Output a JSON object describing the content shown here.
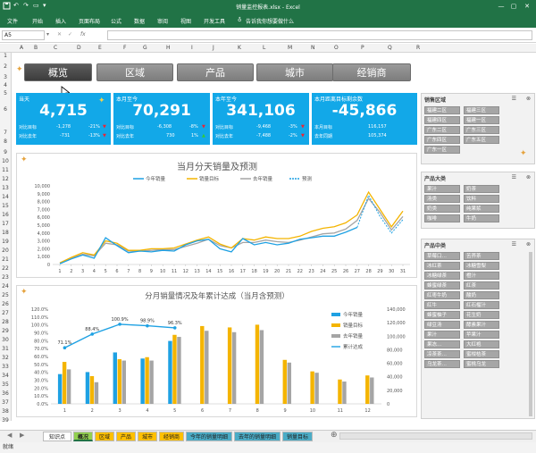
{
  "window": {
    "title": "销量监控报表.xlsx - Excel"
  },
  "ribbon": {
    "tabs": [
      "文件",
      "开始",
      "插入",
      "页面布局",
      "公式",
      "数据",
      "审阅",
      "视图",
      "开发工具"
    ],
    "search": "告诉我你想要做什么"
  },
  "formula": {
    "namebox": "A5",
    "fx": "fx"
  },
  "columns": [
    "A",
    "B",
    "C",
    "D",
    "E",
    "F",
    "G",
    "H",
    "I",
    "J",
    "K",
    "L",
    "M",
    "N",
    "O",
    "P",
    "Q",
    "R"
  ],
  "rows": [
    "1",
    "2",
    "3",
    "4",
    "5",
    "6",
    "7",
    "8",
    "9",
    "10",
    "11",
    "12",
    "13",
    "14",
    "15",
    "16",
    "17",
    "18",
    "19",
    "20",
    "21",
    "22",
    "23",
    "24",
    "25",
    "26",
    "27",
    "28",
    "29",
    "30",
    "31",
    "32",
    "33",
    "34",
    "35",
    "36",
    "37",
    "38",
    "39",
    "40",
    "41"
  ],
  "nav": [
    "概览",
    "区域",
    "产品",
    "城市",
    "经销商"
  ],
  "kpis": [
    {
      "label": "当天",
      "value": "4,715",
      "r1": [
        "对比目标",
        "-1,278",
        "-21%"
      ],
      "r2": [
        "对比去年",
        "-731",
        "-13%"
      ]
    },
    {
      "label": "本月至今",
      "value": "70,291",
      "r1": [
        "对比目标",
        "-6,308",
        "-8%"
      ],
      "r2": [
        "对比去年",
        "730",
        "1%"
      ]
    },
    {
      "label": "本年至今",
      "value": "341,106",
      "r1": [
        "对比目标",
        "-9,468",
        "-3%"
      ],
      "r2": [
        "对比去年",
        "-7,488",
        "-2%"
      ]
    },
    {
      "label": "本月距离目标剩余数",
      "value": "-45,866",
      "r1": [
        "本月目标",
        "116,157",
        ""
      ],
      "r2": [
        "去年同期",
        "105,374",
        ""
      ]
    }
  ],
  "slicers": [
    {
      "title": "销售区域",
      "items": [
        "福建二区",
        "福建三区",
        "福建四区",
        "福建一区",
        "广东二区",
        "广东三区",
        "广东四区",
        "广东五区",
        "广东一区",
        ""
      ]
    },
    {
      "title": "产品大类",
      "items": [
        "果汁",
        "奶茶",
        "汤类",
        "饮料",
        "奶类",
        "纯果浆",
        "咖啡",
        "牛奶"
      ]
    },
    {
      "title": "产品中类",
      "items": [
        "草莓口…",
        "苦荞茶",
        "冰红茶",
        "冰糖雪梨",
        "冰糖绿茶",
        "橙汁",
        "蜂蜜绿茶",
        "红茶",
        "红枣牛奶",
        "酸奶",
        "红牛",
        "红石榴汁",
        "蜂蜜柚子",
        "花生奶",
        "绿豆汤",
        "酵素果汁",
        "果汁",
        "苹果汁",
        "果冻…",
        "大红袍",
        "凉茶茶…",
        "蜜柑桔茶",
        "乌龙茶…",
        "蜜桃乌龙"
      ]
    }
  ],
  "chart_line": {
    "title": "当月分天销量及预测",
    "legend": [
      "今年销量",
      "销量目标",
      "去年销量",
      "预测"
    ],
    "colors": [
      "#1ea1e3",
      "#f4b400",
      "#a5a5a5",
      "#1ea1e3"
    ],
    "yticks": [
      "0",
      "1,000",
      "2,000",
      "3,000",
      "4,000",
      "5,000",
      "6,000",
      "7,000",
      "8,000",
      "9,000",
      "10,000"
    ]
  },
  "chart_data": [
    {
      "type": "line",
      "title": "当月分天销量及预测",
      "x": [
        1,
        2,
        3,
        4,
        5,
        6,
        7,
        8,
        9,
        10,
        11,
        12,
        13,
        14,
        15,
        16,
        17,
        18,
        19,
        20,
        21,
        22,
        23,
        24,
        25,
        26,
        27,
        28,
        29,
        30,
        31
      ],
      "ylim": [
        0,
        10000
      ],
      "series": [
        {
          "name": "今年销量",
          "values": [
            100,
            700,
            1200,
            800,
            3400,
            2400,
            1500,
            1700,
            1600,
            1800,
            1700,
            2500,
            3000,
            3200,
            2000,
            1600,
            3300,
            2500,
            2800,
            2500,
            2700,
            3200,
            3400,
            3600,
            3600,
            4100,
            4715,
            null,
            null,
            null,
            null
          ]
        },
        {
          "name": "销量目标",
          "values": [
            200,
            900,
            1500,
            1200,
            3000,
            2700,
            1800,
            1800,
            2000,
            2000,
            2100,
            2600,
            3100,
            3500,
            2600,
            2100,
            3300,
            3100,
            3500,
            3300,
            3300,
            3600,
            4200,
            4600,
            4800,
            5300,
            6300,
            9200,
            7000,
            4800,
            6800
          ]
        },
        {
          "name": "去年销量",
          "values": [
            200,
            800,
            1300,
            1100,
            2700,
            2500,
            1700,
            1700,
            1800,
            1900,
            1900,
            2300,
            2700,
            3200,
            2400,
            2100,
            2800,
            2800,
            3100,
            2900,
            2800,
            3100,
            3500,
            3900,
            4000,
            4500,
            5600,
            8400,
            6600,
            4400,
            6100
          ]
        },
        {
          "name": "预测",
          "values": [
            null,
            null,
            null,
            null,
            null,
            null,
            null,
            null,
            null,
            null,
            null,
            null,
            null,
            null,
            null,
            null,
            null,
            null,
            null,
            null,
            null,
            null,
            null,
            null,
            null,
            null,
            4715,
            8800,
            6100,
            4000,
            5700
          ]
        }
      ]
    },
    {
      "type": "bar",
      "title": "分月销量情况及年累计达成（当月含预测）",
      "categories": [
        "1",
        "2",
        "3",
        "4",
        "5",
        "6",
        "7",
        "8",
        "9",
        "10",
        "11",
        "12"
      ],
      "ylim": [
        0,
        140000
      ],
      "y2lim": [
        0,
        1.2
      ],
      "series": [
        {
          "name": "今年销量",
          "values": [
            44000,
            47000,
            76000,
            67000,
            93000,
            null,
            null,
            null,
            null,
            null,
            null,
            null
          ]
        },
        {
          "name": "销量目标",
          "values": [
            62000,
            41000,
            66000,
            69000,
            102000,
            115000,
            113000,
            117000,
            65000,
            48000,
            36000,
            42000
          ]
        },
        {
          "name": "去年销量",
          "values": [
            51000,
            32000,
            64000,
            64000,
            99000,
            108000,
            106000,
            109000,
            61000,
            46000,
            33000,
            39000
          ]
        },
        {
          "name": "累计达成",
          "values": [
            0.711,
            0.884,
            1.009,
            0.989,
            0.963,
            null,
            null,
            null,
            null,
            null,
            null,
            null
          ]
        }
      ]
    }
  ],
  "chart_bar": {
    "title": "分月销量情况及年累计达成（当月含预测）",
    "legend": [
      "今年销量",
      "销量目标",
      "去年销量",
      "累计达成"
    ],
    "colors": [
      "#1ea1e3",
      "#f4b400",
      "#a5a5a5",
      "#1ea1e3"
    ],
    "yticks": [
      "0.0%",
      "10.0%",
      "20.0%",
      "30.0%",
      "40.0%",
      "50.0%",
      "60.0%",
      "70.0%",
      "80.0%",
      "90.0%",
      "100.0%",
      "110.0%",
      "120.0%"
    ],
    "y2ticks": [
      "0",
      "20,000",
      "40,000",
      "60,000",
      "80,000",
      "100,000",
      "120,000",
      "140,000"
    ],
    "pct_labels": [
      "71.1%",
      "88.4%",
      "100.9%",
      "98.9%",
      "96.3%"
    ]
  },
  "sheet_tabs": [
    {
      "name": "知识点",
      "color": "#ffffff"
    },
    {
      "name": "概况",
      "color": "#92d050"
    },
    {
      "name": "区域",
      "color": "#ffc000"
    },
    {
      "name": "产品",
      "color": "#ffc000"
    },
    {
      "name": "城市",
      "color": "#ffc000"
    },
    {
      "name": "经销商",
      "color": "#ffc000"
    },
    {
      "name": "今年的销量明细",
      "color": "#4bacc6"
    },
    {
      "name": "去年的销量明细",
      "color": "#4bacc6"
    },
    {
      "name": "销量目标",
      "color": "#4bacc6"
    }
  ],
  "status": {
    "text": "就绪"
  }
}
